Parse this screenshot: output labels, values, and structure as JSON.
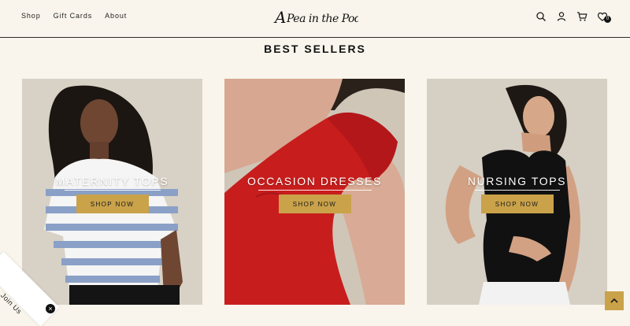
{
  "header": {
    "nav": [
      "Shop",
      "Gift Cards",
      "About"
    ],
    "logo_text": "A Pea in the Pod",
    "cart_count": "0",
    "icons": [
      "search-icon",
      "account-icon",
      "cart-icon",
      "wishlist-icon"
    ]
  },
  "section": {
    "title": "BEST SELLERS"
  },
  "cards": [
    {
      "title": "MATERNITY TOPS",
      "button": "SHOP NOW"
    },
    {
      "title": "OCCASION DRESSES",
      "button": "SHOP NOW"
    },
    {
      "title": "NURSING TOPS",
      "button": "SHOP NOW"
    }
  ],
  "join": {
    "label": "Join Us",
    "close": "×"
  },
  "colors": {
    "accent": "#c9a24a",
    "background": "#f9f5ec"
  }
}
